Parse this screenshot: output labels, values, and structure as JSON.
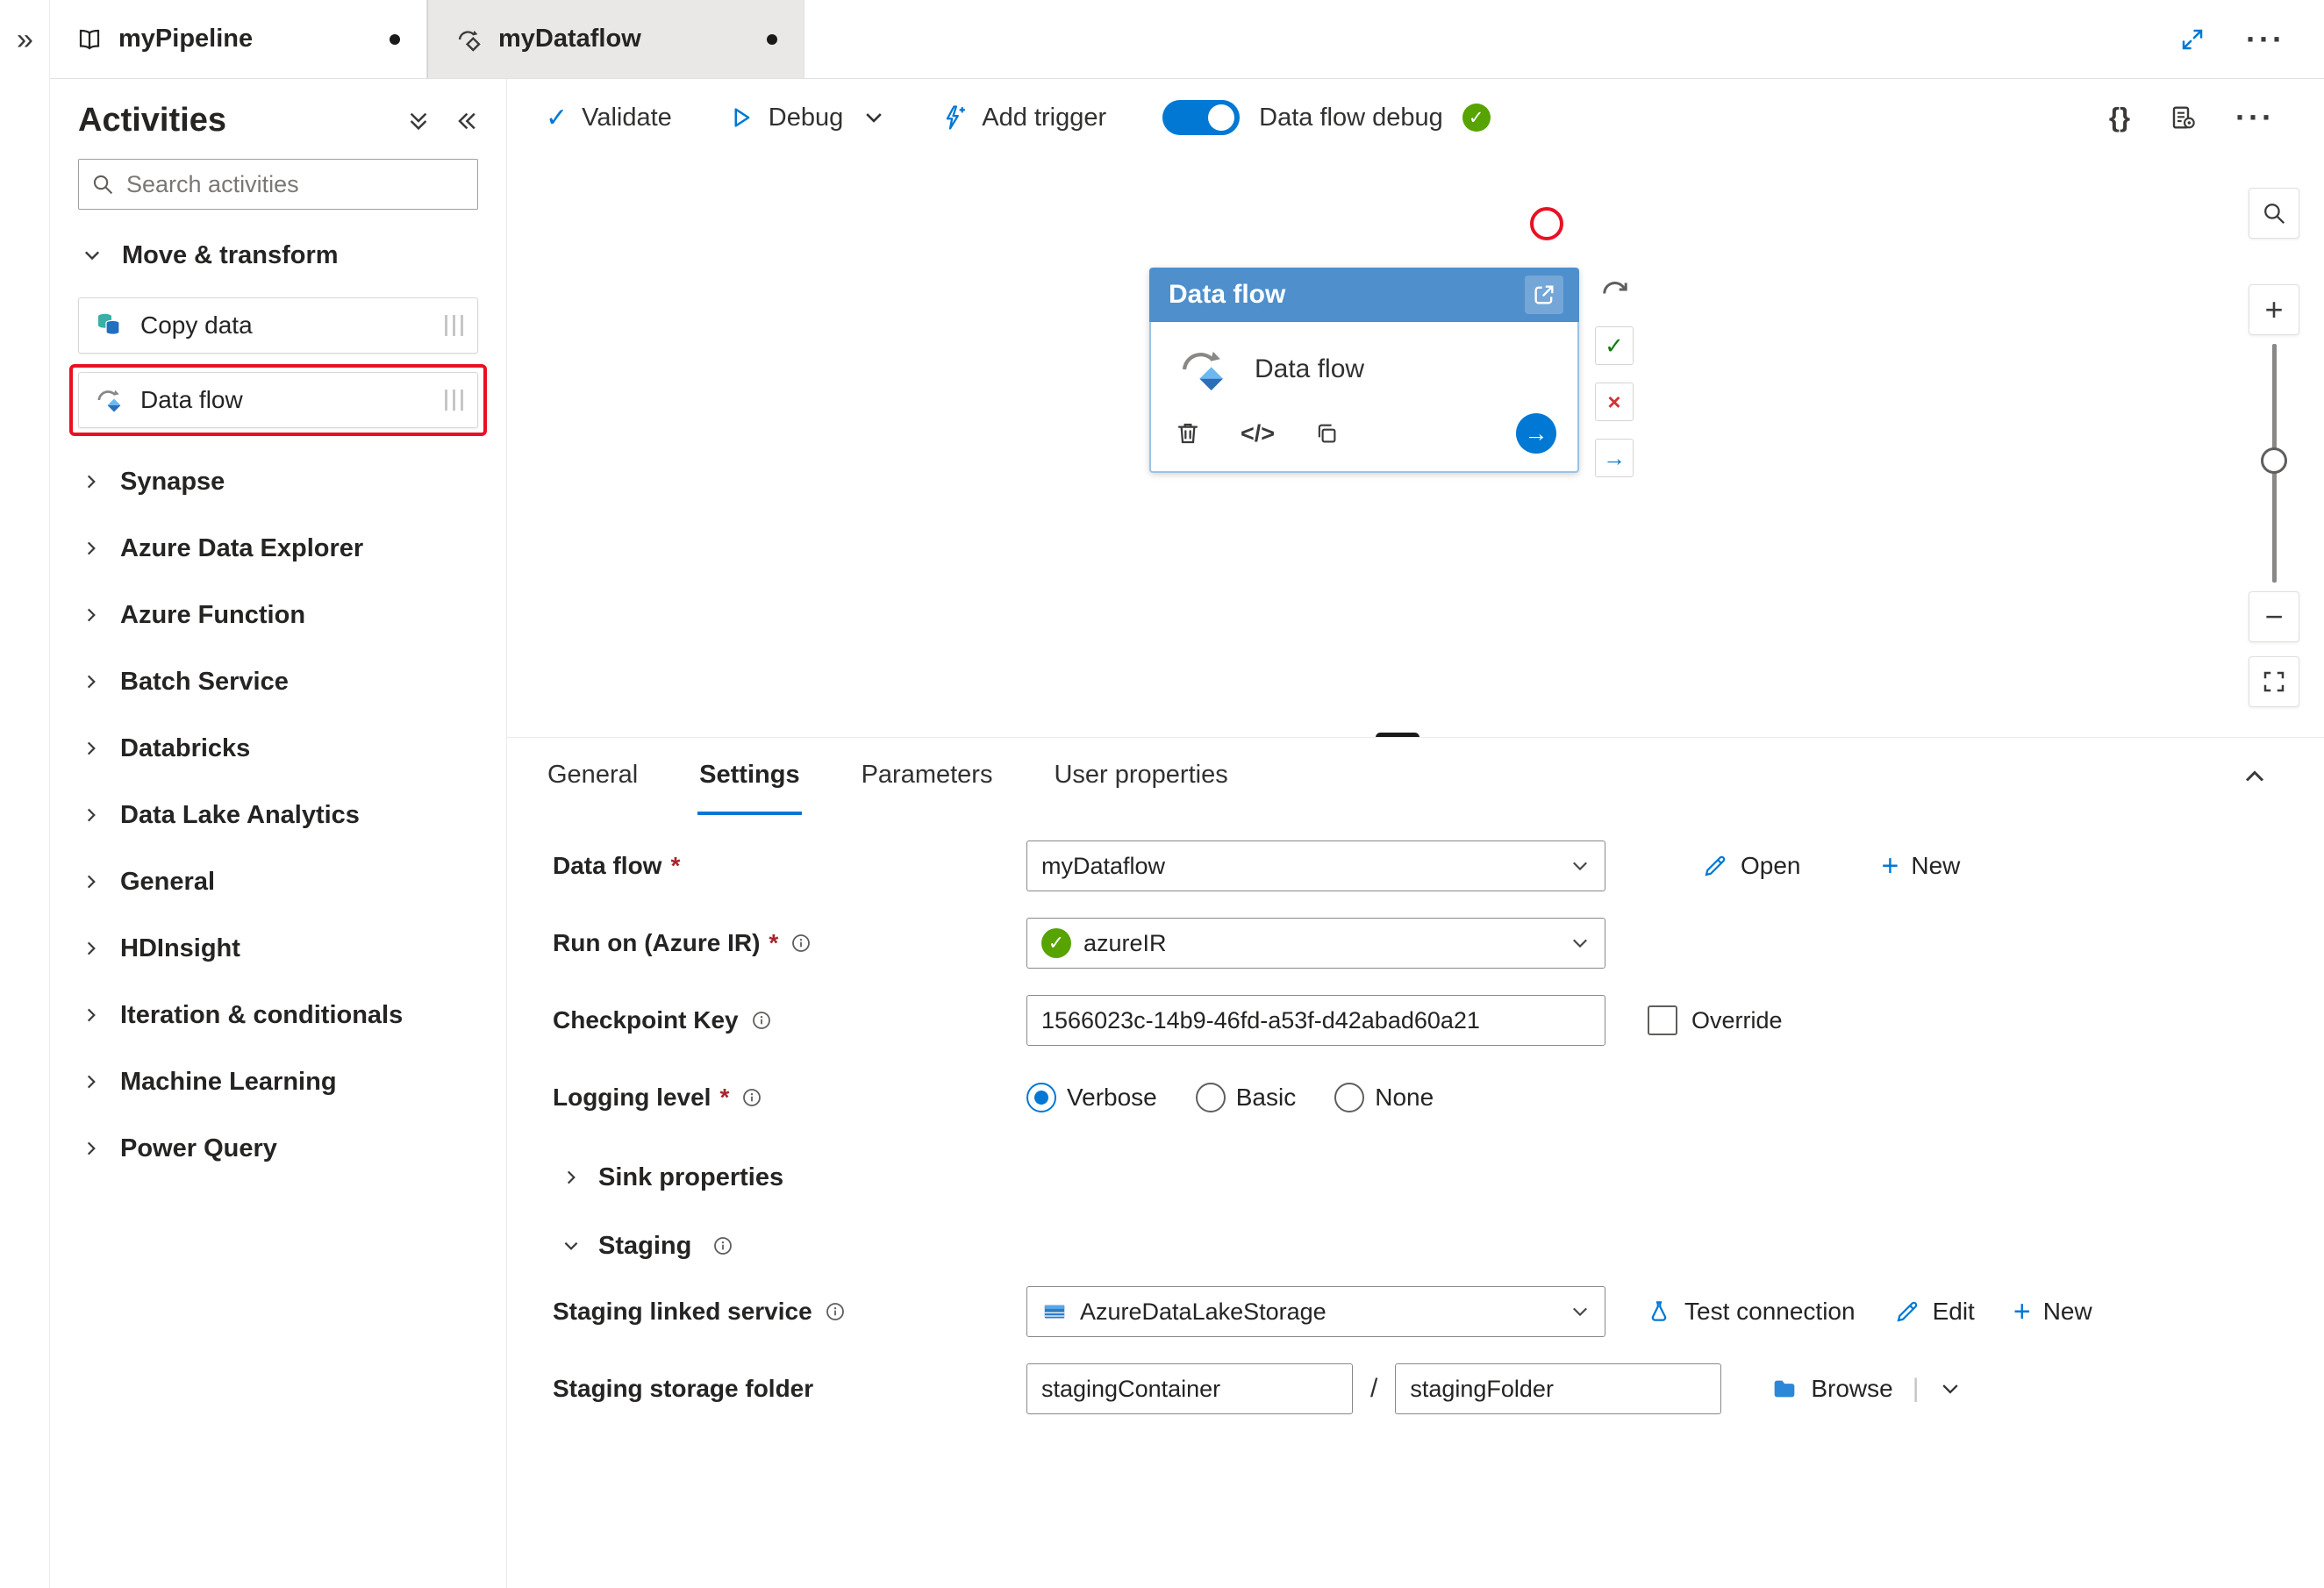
{
  "glyphs": {
    "rail_expand": "»",
    "ellipsis": "···",
    "braces": "{}",
    "code_tag": "</>",
    "arrow_right": "→",
    "check": "✓",
    "cross": "×",
    "plus": "+",
    "minus": "−",
    "required": "*",
    "divider": "|",
    "slash": "/"
  },
  "colors": {
    "accent": "#0078d4",
    "node_header": "#4e8fcc",
    "annotation_red": "#e81123",
    "success_green": "#57a300"
  },
  "tabs": [
    {
      "label": "myPipeline",
      "dirty": true,
      "active": false
    },
    {
      "label": "myDataflow",
      "dirty": true,
      "active": true
    }
  ],
  "activities": {
    "title": "Activities",
    "search_placeholder": "Search activities",
    "sections": [
      {
        "label": "Move & transform",
        "expanded": true,
        "items": [
          {
            "label": "Copy data"
          },
          {
            "label": "Data flow",
            "highlighted": true
          }
        ]
      },
      {
        "label": "Synapse"
      },
      {
        "label": "Azure Data Explorer"
      },
      {
        "label": "Azure Function"
      },
      {
        "label": "Batch Service"
      },
      {
        "label": "Databricks"
      },
      {
        "label": "Data Lake Analytics"
      },
      {
        "label": "General"
      },
      {
        "label": "HDInsight"
      },
      {
        "label": "Iteration & conditionals"
      },
      {
        "label": "Machine Learning"
      },
      {
        "label": "Power Query"
      }
    ]
  },
  "toolbar": {
    "validate": "Validate",
    "debug": "Debug",
    "add_trigger": "Add trigger",
    "debug_toggle": "Data flow debug",
    "debug_toggle_on": true
  },
  "canvas": {
    "node": {
      "title": "Data flow",
      "label": "Data flow"
    }
  },
  "panel": {
    "tabs": [
      "General",
      "Settings",
      "Parameters",
      "User properties"
    ],
    "active_tab": "Settings",
    "fields": {
      "data_flow": {
        "label": "Data flow",
        "required": true,
        "value": "myDataflow",
        "open": "Open",
        "new": "New"
      },
      "run_on": {
        "label": "Run on (Azure IR)",
        "required": true,
        "value": "azureIR"
      },
      "checkpoint": {
        "label": "Checkpoint Key",
        "value": "1566023c-14b9-46fd-a53f-d42abad60a21",
        "override": "Override"
      },
      "logging": {
        "label": "Logging level",
        "required": true,
        "options": [
          "Verbose",
          "Basic",
          "None"
        ],
        "selected": "Verbose"
      },
      "sink": {
        "label": "Sink properties"
      },
      "staging": {
        "label": "Staging"
      },
      "linked_service": {
        "label": "Staging linked service",
        "value": "AzureDataLakeStorage",
        "test": "Test connection",
        "edit": "Edit",
        "new": "New"
      },
      "storage_folder": {
        "label": "Staging storage folder",
        "container": "stagingContainer",
        "folder": "stagingFolder",
        "browse": "Browse"
      }
    }
  }
}
